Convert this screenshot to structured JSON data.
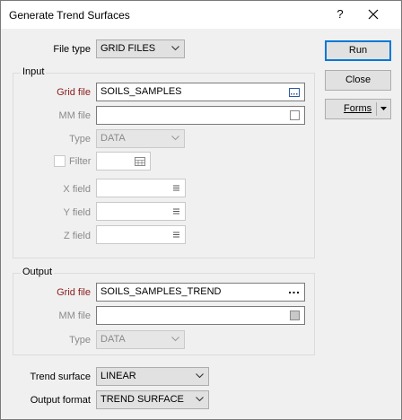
{
  "window": {
    "title": "Generate Trend Surfaces",
    "help": "?",
    "close": "✕"
  },
  "top": {
    "file_type_label": "File type",
    "file_type_value": "GRID FILES"
  },
  "input": {
    "group_title": "Input",
    "grid_file_label": "Grid file",
    "grid_file_value": "SOILS_SAMPLES",
    "mm_file_label": "MM file",
    "mm_file_value": "",
    "type_label": "Type",
    "type_value": "DATA",
    "filter_label": "Filter",
    "filter_checked": false,
    "x_field_label": "X field",
    "y_field_label": "Y field",
    "z_field_label": "Z field"
  },
  "output": {
    "group_title": "Output",
    "grid_file_label": "Grid file",
    "grid_file_value": "SOILS_SAMPLES_TREND",
    "mm_file_label": "MM file",
    "mm_file_value": "",
    "type_label": "Type",
    "type_value": "DATA"
  },
  "options": {
    "trend_surface_label": "Trend surface",
    "trend_surface_value": "LINEAR",
    "output_format_label": "Output format",
    "output_format_value": "TREND SURFACE"
  },
  "buttons": {
    "run": "Run",
    "close": "Close",
    "forms": "Forms"
  },
  "colors": {
    "required_label": "#8b1a1a",
    "disabled_text": "#8a8a8a",
    "primary_border": "#0078d7"
  }
}
